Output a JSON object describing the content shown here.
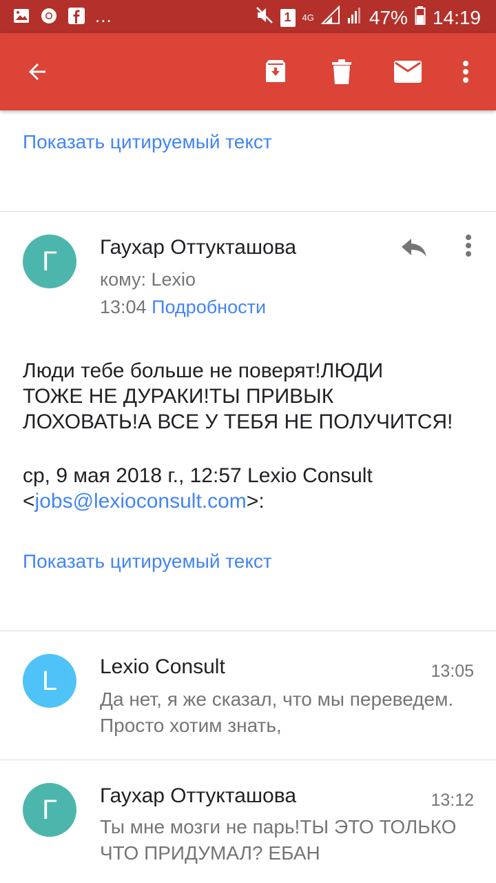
{
  "status_bar": {
    "notification_icons": [
      "image-icon",
      "chrome-icon",
      "facebook-icon"
    ],
    "overflow": "...",
    "sim_badge": "1",
    "network": "4G",
    "battery": "47%",
    "time": "14:19"
  },
  "toolbar": {
    "back": "back-arrow-icon",
    "archive": "archive-icon",
    "delete": "trash-icon",
    "mark_unread": "mail-icon",
    "more": "more-vert-icon"
  },
  "top": {
    "show_quoted": "Показать цитируемый текст"
  },
  "message": {
    "avatar_letter": "Г",
    "sender": "Гаухар Оттукташова",
    "to": "кому: Lexio",
    "time": "13:04",
    "details": "Подробности",
    "body_line1": "Люди тебе больше не поверят!ЛЮДИ",
    "body_line2": "ТОЖЕ НЕ ДУРАКИ!ТЫ ПРИВЫК",
    "body_line3": "ЛОХОВАТЬ!А ВСЕ У ТЕБЯ НЕ ПОЛУЧИТСЯ!",
    "quote_header_line1": "ср, 9 мая 2018 г., 12:57 Lexio Consult",
    "quote_lt": "<",
    "quote_email": "jobs@lexioconsult.com",
    "quote_gt": ">:",
    "show_quoted": "Показать цитируемый текст"
  },
  "thread": [
    {
      "avatar_letter": "L",
      "sender": "Lexio Consult",
      "time": "13:05",
      "snippet": "Да нет, я же сказал, что мы переведем. Просто хотим знать,"
    },
    {
      "avatar_letter": "Г",
      "sender": "Гаухар Оттукташова",
      "time": "13:12",
      "snippet": "Ты мне мозги не парь!ТЫ ЭТО ТОЛЬКО ЧТО ПРИДУМАЛ? ЕБАН"
    }
  ],
  "colors": {
    "status_bar": "#b3312a",
    "toolbar": "#db4437",
    "link": "#4285f4",
    "avatar_teal": "#4db6ac",
    "avatar_blue": "#4fc3f7"
  }
}
